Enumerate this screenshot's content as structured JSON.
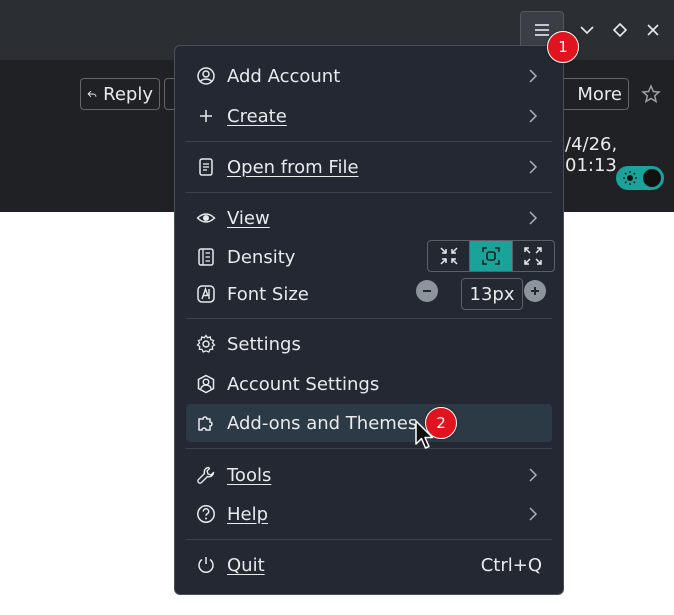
{
  "toolbar": {
    "reply_label": "Reply",
    "more_label": "More",
    "date_text": "/4/26, 01:13"
  },
  "menu": {
    "items": [
      {
        "label": "Add Account",
        "has_submenu": true
      },
      {
        "label": "Create",
        "has_submenu": true
      },
      {
        "label": "Open from File",
        "has_submenu": true
      },
      {
        "label": "View",
        "has_submenu": true
      },
      {
        "label": "Density"
      },
      {
        "label": "Font Size"
      },
      {
        "label": "Settings"
      },
      {
        "label": "Account Settings"
      },
      {
        "label": "Add-ons and Themes",
        "highlighted": true
      },
      {
        "label": "Tools",
        "has_submenu": true
      },
      {
        "label": "Help",
        "has_submenu": true
      },
      {
        "label": "Quit",
        "shortcut": "Ctrl+Q"
      }
    ],
    "font_size_value": "13px",
    "density_selected": "normal"
  },
  "annotations": {
    "badge1": "1",
    "badge2": "2"
  },
  "colors": {
    "accent": "#1aa39a",
    "menu_bg": "#232832",
    "badge": "#e0141e"
  }
}
